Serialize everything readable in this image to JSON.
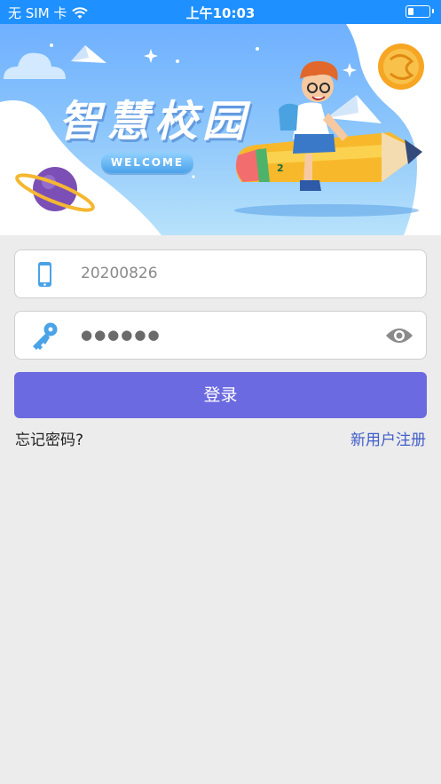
{
  "status_bar": {
    "carrier": "无 SIM 卡",
    "time": "上午10:03"
  },
  "banner": {
    "title": "智慧校园",
    "welcome": "WELCOME",
    "illustration": "boy-riding-pencil-rocket"
  },
  "account_field": {
    "icon": "phone-icon",
    "value": "20200826"
  },
  "password_field": {
    "icon": "key-icon",
    "masked_value": "●●●●●●",
    "toggle_icon": "eye-icon"
  },
  "login_button": {
    "label": "登录"
  },
  "links": {
    "forgot_password": "忘记密码?",
    "register": "新用户注册"
  },
  "colors": {
    "status_bar": "#1e90ff",
    "primary_button": "#6c6ae0",
    "link": "#3f5cc9",
    "background": "#ececec"
  }
}
